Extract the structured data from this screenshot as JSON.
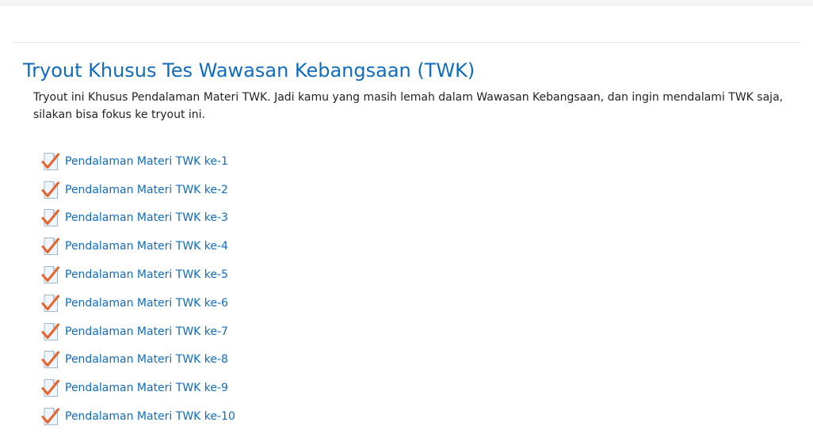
{
  "section": {
    "title": "Tryout Khusus Tes Wawasan Kebangsaan (TWK)",
    "summary": "Tryout ini Khusus Pendalaman Materi TWK. Jadi kamu yang masih lemah dalam Wawasan Kebangsaan, dan ingin mendalami TWK saja, silakan bisa fokus ke tryout ini."
  },
  "activities": [
    {
      "label": "Pendalaman Materi TWK ke-1",
      "icon": "quiz-checkmark-icon"
    },
    {
      "label": "Pendalaman Materi TWK ke-2",
      "icon": "quiz-checkmark-icon"
    },
    {
      "label": "Pendalaman Materi TWK ke-3",
      "icon": "quiz-checkmark-icon"
    },
    {
      "label": "Pendalaman Materi TWK ke-4",
      "icon": "quiz-checkmark-icon"
    },
    {
      "label": "Pendalaman Materi TWK ke-5",
      "icon": "quiz-checkmark-icon"
    },
    {
      "label": "Pendalaman Materi TWK ke-6",
      "icon": "quiz-checkmark-icon"
    },
    {
      "label": "Pendalaman Materi TWK ke-7",
      "icon": "quiz-checkmark-icon"
    },
    {
      "label": "Pendalaman Materi TWK ke-8",
      "icon": "quiz-checkmark-icon"
    },
    {
      "label": "Pendalaman Materi TWK ke-9",
      "icon": "quiz-checkmark-icon"
    },
    {
      "label": "Pendalaman Materi TWK ke-10",
      "icon": "quiz-checkmark-icon"
    }
  ],
  "colors": {
    "link": "#0f6cbf",
    "text": "#222222",
    "check": "#e8632b"
  }
}
